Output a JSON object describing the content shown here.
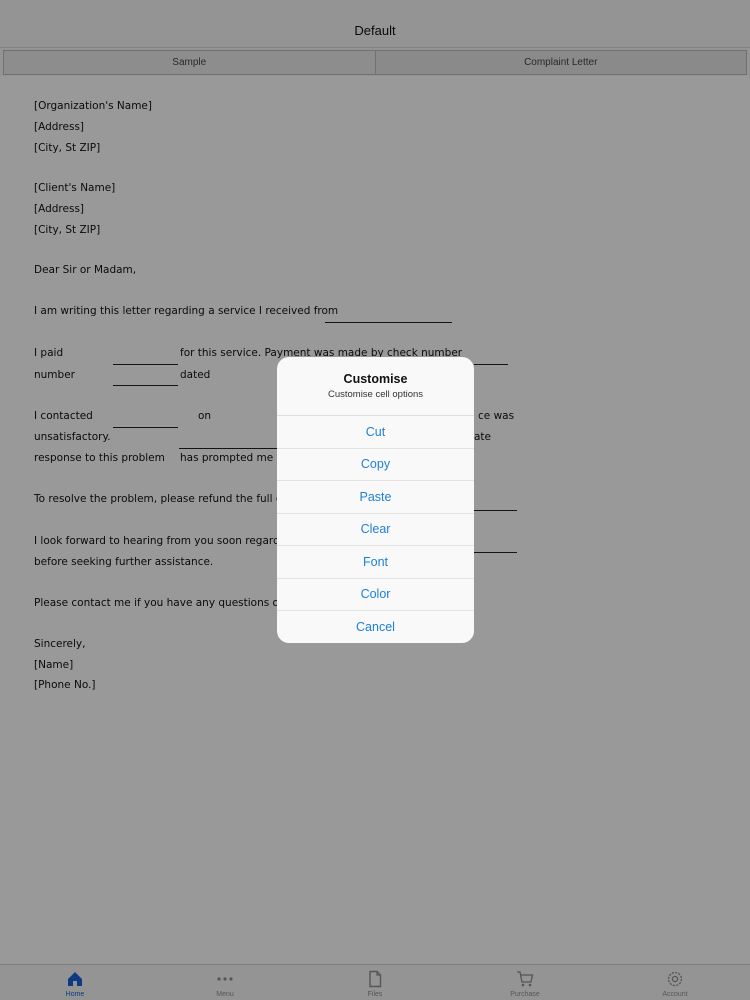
{
  "nav": {
    "title": "Default"
  },
  "tabs": [
    {
      "label": "Sample"
    },
    {
      "label": "Complaint Letter"
    }
  ],
  "letter": {
    "org_name": "[Organization's Name]",
    "org_address": "[Address]",
    "org_city": "[City, St ZIP]",
    "client_name": "[Client's Name]",
    "client_address": "[Address]",
    "client_city": "[City, St ZIP]",
    "salutation": "Dear Sir or Madam,",
    "p1": "I am writing this letter regarding a service I received from",
    "p2a": "I paid",
    "p2b": "for this service. Payment was made by check  number",
    "p2c": "number",
    "p2d": "dated",
    "p3a": "I contacted",
    "p3b": "on",
    "p3c": "ce was",
    "p3d": "unsatisfactory.",
    "p3e": "ate",
    "p3f": "response to this problem",
    "p3g": "has prompted me  t",
    "p4": "To resolve the problem, please refund the full co",
    "p5a": "I look forward to hearing from you soon regarding",
    "p5b": "before seeking further assistance.",
    "p6": "Please contact me if you have any questions or n",
    "closing": "Sincerely,",
    "sign_name": "[Name]",
    "sign_phone": "[Phone No.]"
  },
  "popup": {
    "title": "Customise",
    "subtitle": "Customise cell options",
    "buttons": [
      "Cut",
      "Copy",
      "Paste",
      "Clear",
      "Font",
      "Color",
      "Cancel"
    ],
    "accent": "#1d7fd8"
  },
  "tabbar": {
    "items": [
      {
        "label": "Home",
        "icon": "home-icon"
      },
      {
        "label": "Menu",
        "icon": "more-dots-icon"
      },
      {
        "label": "Files",
        "icon": "file-icon"
      },
      {
        "label": "Purchase",
        "icon": "cart-icon"
      },
      {
        "label": "Account",
        "icon": "gear-icon"
      }
    ],
    "active_color": "#1a5fd8"
  }
}
